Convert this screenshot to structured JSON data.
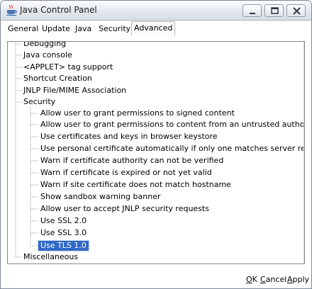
{
  "window": {
    "title": "Java Control Panel"
  },
  "title_buttons": {
    "minimize": "minimize",
    "maximize": "maximize",
    "close": "close"
  },
  "tabs": [
    {
      "label": "General"
    },
    {
      "label": "Update"
    },
    {
      "label": "Java"
    },
    {
      "label": "Security"
    },
    {
      "label": "Advanced",
      "active": true
    }
  ],
  "tree": {
    "groups": [
      {
        "label": "Debugging"
      },
      {
        "label": "Java console"
      },
      {
        "label": "<APPLET> tag support"
      },
      {
        "label": "Shortcut Creation"
      },
      {
        "label": "JNLP File/MIME Association"
      },
      {
        "label": "Security"
      }
    ],
    "security_items": [
      {
        "label": "Allow user to grant permissions to signed content"
      },
      {
        "label": "Allow user to grant permissions to content from an untrusted authority"
      },
      {
        "label": "Use certificates and keys in browser keystore"
      },
      {
        "label": "Use personal certificate automatically if only one matches server request"
      },
      {
        "label": "Warn if certificate authority can not be verified"
      },
      {
        "label": "Warn if certificate is expired or not yet valid"
      },
      {
        "label": "Warn if site certificate does not match hostname"
      },
      {
        "label": "Show sandbox warning banner"
      },
      {
        "label": "Allow user to accept JNLP security requests"
      },
      {
        "label": "Use SSL 2.0"
      },
      {
        "label": "Use SSL 3.0"
      },
      {
        "label": "Use TLS 1.0",
        "selected": true
      }
    ],
    "last_group": {
      "label": "Miscellaneous"
    }
  },
  "footer": {
    "ok": {
      "mnemonic": "O",
      "rest": "K"
    },
    "cancel": {
      "mnemonic": "C",
      "rest": "ancel"
    },
    "apply": {
      "mnemonic": "A",
      "rest": "pply"
    }
  },
  "colors": {
    "selection": "#3169c6",
    "tree_line": "#a0a0a0",
    "window_border": "#7a8a99"
  }
}
